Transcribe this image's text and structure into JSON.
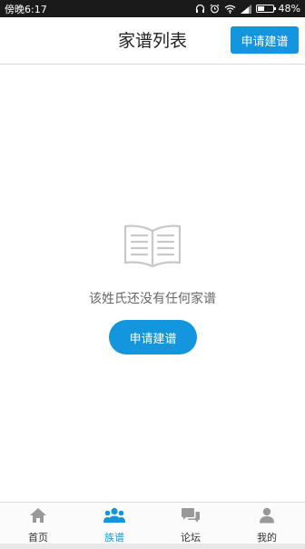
{
  "status_bar": {
    "time": "傍晚6:17",
    "battery": "48%",
    "battery_level": 0.48
  },
  "header": {
    "title": "家谱列表",
    "apply_button": "申请建谱"
  },
  "empty_state": {
    "icon": "open-book-icon",
    "message": "该姓氏还没有任何家谱",
    "button": "申请建谱"
  },
  "tabs": [
    {
      "label": "首页",
      "icon": "home-icon",
      "active": false
    },
    {
      "label": "族谱",
      "icon": "people-icon",
      "active": true
    },
    {
      "label": "论坛",
      "icon": "chat-icon",
      "active": false
    },
    {
      "label": "我的",
      "icon": "person-icon",
      "active": false
    }
  ],
  "colors": {
    "accent": "#1496de",
    "inactive_icon": "#999999",
    "status_bar": "#1a1a1a"
  }
}
